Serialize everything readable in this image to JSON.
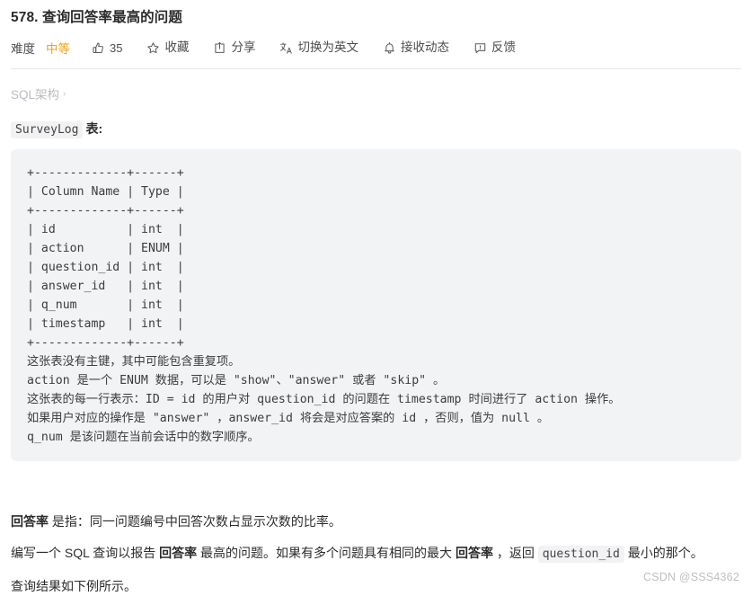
{
  "title": "578. 查询回答率最高的问题",
  "actionbar": {
    "difficulty_label": "难度",
    "difficulty_value": "中等",
    "like_count": "35",
    "favorite_label": "收藏",
    "share_label": "分享",
    "translate_label": "切换为英文",
    "subscribe_label": "接收动态",
    "feedback_label": "反馈",
    "icons": {
      "like": "thumbs-up-icon",
      "favorite": "star-icon",
      "share": "share-box-icon",
      "translate": "translate-icon",
      "subscribe": "bell-icon",
      "feedback": "feedback-bubble-icon"
    }
  },
  "schema_link": {
    "label": "SQL架构",
    "chevron": "›"
  },
  "table_intro": {
    "table_name": "SurveyLog",
    "suffix": "表:"
  },
  "code_block": {
    "content": "+-------------+------+\n| Column Name | Type |\n+-------------+------+\n| id          | int  |\n| action      | ENUM |\n| question_id | int  |\n| answer_id   | int  |\n| q_num       | int  |\n| timestamp   | int  |\n+-------------+------+\n这张表没有主键，其中可能包含重复项。\naction 是一个 ENUM 数据，可以是 \"show\"、\"answer\" 或者 \"skip\" 。\n这张表的每一行表示：ID = id 的用户对 question_id 的问题在 timestamp 时间进行了 action 操作。\n如果用户对应的操作是 \"answer\" ，answer_id 将会是对应答案的 id ，否则，值为 null 。\nq_num 是该问题在当前会话中的数字顺序。"
  },
  "paragraphs": {
    "p1": {
      "bold_term": "回答率",
      "rest": " 是指：同一问题编号中回答次数占显示次数的比率。"
    },
    "p2": {
      "seg1": "编写一个 SQL 查询以报告 ",
      "bold1": "回答率",
      "seg2": " 最高的问题。如果有多个问题具有相同的最大 ",
      "bold2": "回答率",
      "seg3": " ，返回 ",
      "code1": "question_id",
      "seg4": " 最小的那个。"
    },
    "p3": {
      "text": "查询结果如下例所示。"
    }
  },
  "watermark": "CSDN @SSS4362",
  "colors": {
    "accent_difficulty": "#f0a020",
    "code_bg": "#f2f3f5",
    "inline_code_bg": "#f2f2f4",
    "muted_link": "#b9bcc2",
    "divider": "#e8e8e8",
    "watermark": "#bfbfbf"
  }
}
